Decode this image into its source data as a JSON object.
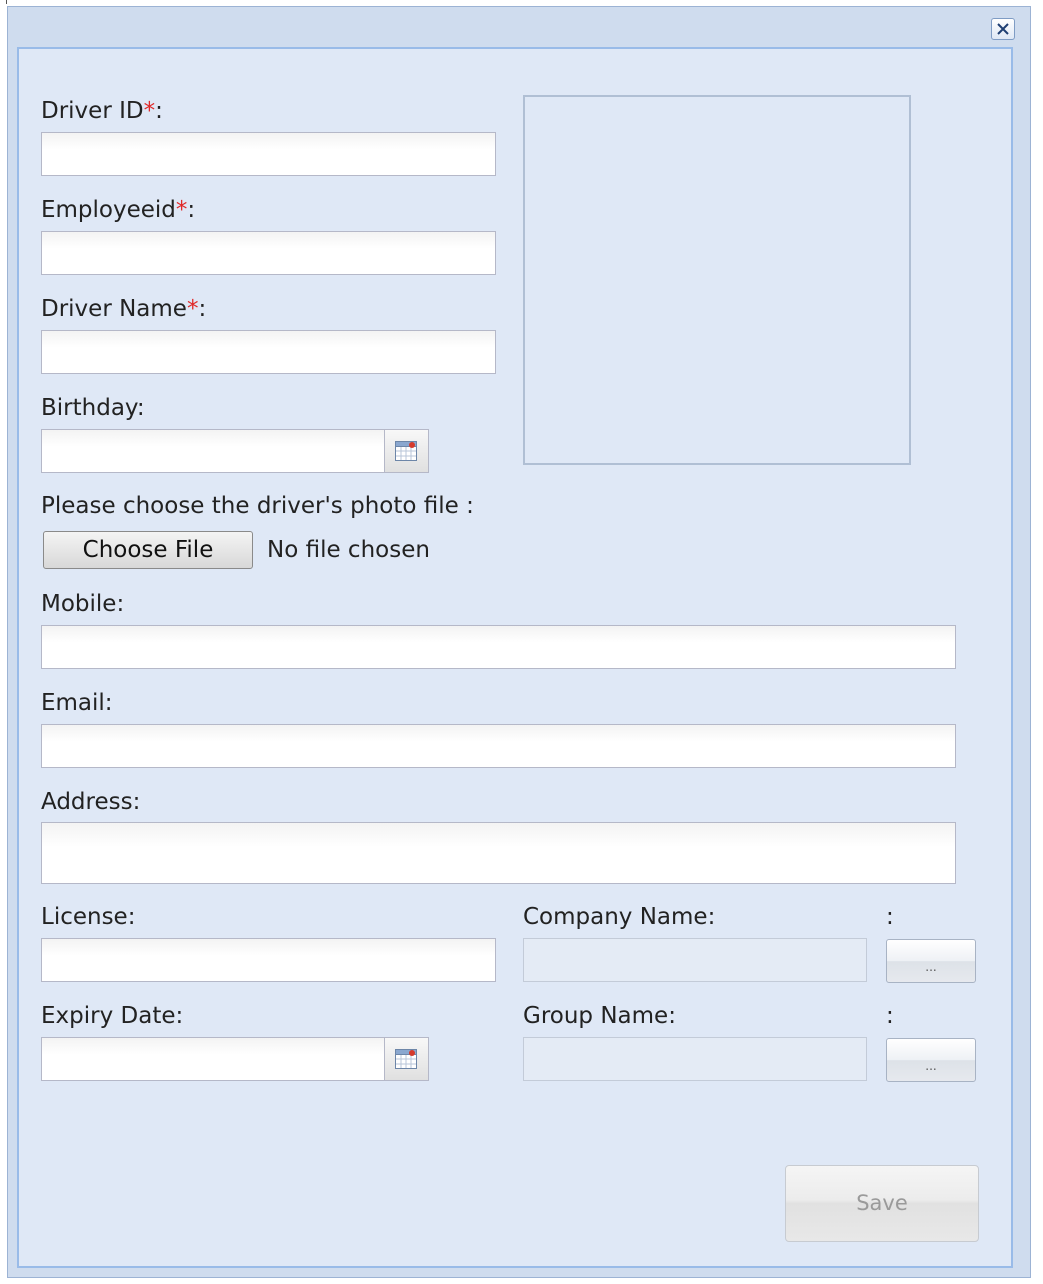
{
  "dialog": {
    "close_icon": "close-icon"
  },
  "form": {
    "driver_id": {
      "label": "Driver ID",
      "required_mark": "*",
      "suffix": ":",
      "value": ""
    },
    "employee_id": {
      "label": "Employeeid",
      "required_mark": "*",
      "suffix": ":",
      "value": ""
    },
    "driver_name": {
      "label": "Driver Name",
      "required_mark": "*",
      "suffix": ":",
      "value": ""
    },
    "birthday": {
      "label": "Birthday:",
      "value": "",
      "icon": "calendar-icon"
    },
    "photo": {
      "prompt": "Please choose the driver's photo file :",
      "button_label": "Choose File",
      "status": "No file chosen"
    },
    "mobile": {
      "label": "Mobile:",
      "value": ""
    },
    "email": {
      "label": "Email:",
      "value": ""
    },
    "address": {
      "label": "Address:",
      "value": ""
    },
    "license": {
      "label": "License:",
      "value": ""
    },
    "company_name": {
      "label": "Company Name:",
      "colon": ":",
      "value": "",
      "button_label": "..."
    },
    "expiry_date": {
      "label": "Expiry Date:",
      "value": "",
      "icon": "calendar-icon"
    },
    "group_name": {
      "label": "Group Name:",
      "colon": ":",
      "value": "",
      "button_label": "..."
    },
    "save_label": "Save"
  },
  "colors": {
    "window_bg": "#cfdcee",
    "panel_bg": "#dfe8f6",
    "panel_border": "#99bbe8",
    "required": "#e02828"
  }
}
